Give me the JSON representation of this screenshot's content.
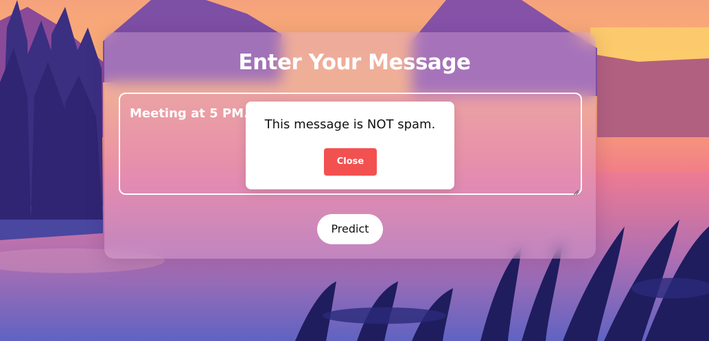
{
  "card": {
    "title": "Enter Your Message"
  },
  "message": {
    "value": "Meeting at 5 PM. D"
  },
  "predict": {
    "label": "Predict"
  },
  "modal": {
    "text": "This message is NOT spam.",
    "close_label": "Close"
  },
  "colors": {
    "close_button": "#f25150",
    "card_title": "#ffffff"
  }
}
